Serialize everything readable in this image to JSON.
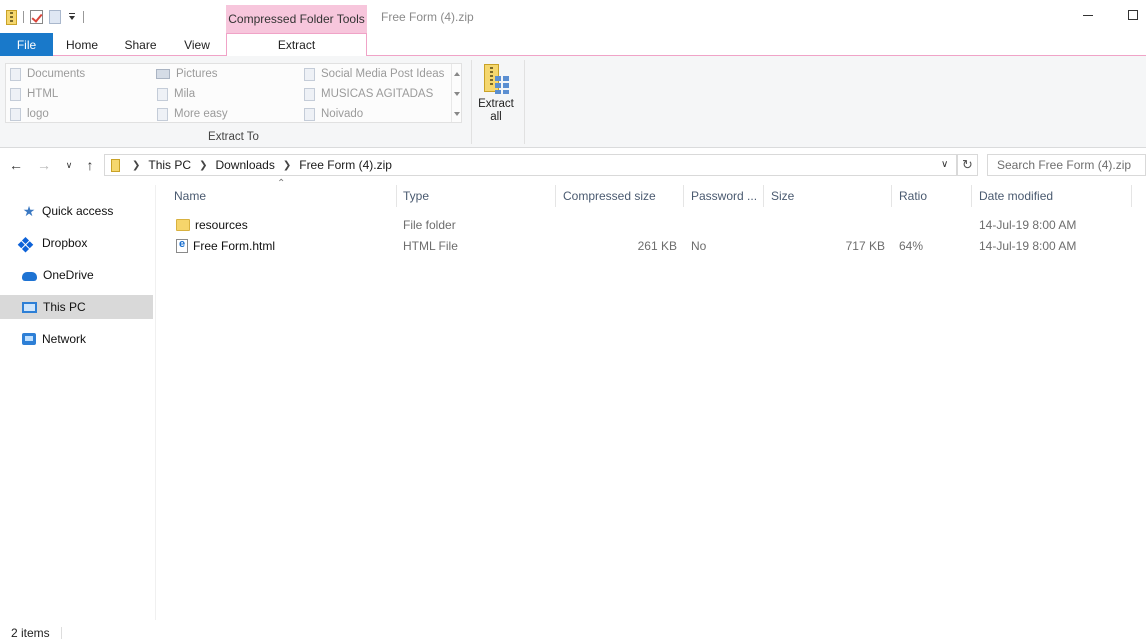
{
  "window": {
    "title": "Free Form (4).zip",
    "context_tab_header": "Compressed Folder Tools"
  },
  "ribbon_tabs": {
    "file": "File",
    "home": "Home",
    "share": "Share",
    "view": "View",
    "extract": "Extract"
  },
  "extract_to": {
    "group_label": "Extract To",
    "items": [
      {
        "label": "Documents",
        "icon": "document-icon"
      },
      {
        "label": "HTML",
        "icon": "document-icon"
      },
      {
        "label": "logo",
        "icon": "document-icon"
      },
      {
        "label": "Pictures",
        "icon": "pictures-icon"
      },
      {
        "label": "Mila",
        "icon": "document-icon"
      },
      {
        "label": "More easy",
        "icon": "document-icon"
      },
      {
        "label": "Social Media Post Ideas",
        "icon": "document-icon"
      },
      {
        "label": "MUSICAS AGITADAS",
        "icon": "document-icon"
      },
      {
        "label": "Noivado",
        "icon": "document-icon"
      }
    ],
    "extract_all_line1": "Extract",
    "extract_all_line2": "all"
  },
  "address": {
    "crumbs": [
      "This PC",
      "Downloads",
      "Free Form (4).zip"
    ]
  },
  "search": {
    "placeholder": "Search Free Form (4).zip"
  },
  "nav_pane": {
    "items": [
      {
        "label": "Quick access",
        "icon": "star-icon"
      },
      {
        "label": "Dropbox",
        "icon": "dropbox-icon"
      },
      {
        "label": "OneDrive",
        "icon": "cloud-icon"
      },
      {
        "label": "This PC",
        "icon": "computer-icon",
        "selected": true
      },
      {
        "label": "Network",
        "icon": "network-icon"
      }
    ]
  },
  "file_list": {
    "columns": [
      "Name",
      "Type",
      "Compressed size",
      "Password ...",
      "Size",
      "Ratio",
      "Date modified"
    ],
    "rows": [
      {
        "name": "resources",
        "type": "File folder",
        "compressed": "",
        "password": "",
        "size": "",
        "ratio": "",
        "date": "14-Jul-19 8:00 AM",
        "icon": "folder-icon"
      },
      {
        "name": "Free Form.html",
        "type": "HTML File",
        "compressed": "261 KB",
        "password": "No",
        "size": "717 KB",
        "ratio": "64%",
        "date": "14-Jul-19 8:00 AM",
        "icon": "html-file-icon"
      }
    ]
  },
  "status": {
    "item_count": "2 items"
  },
  "colors": {
    "file_tab": "#1979ca",
    "context_tab": "#f7c6dc",
    "selected_nav": "#d9d9d9"
  }
}
